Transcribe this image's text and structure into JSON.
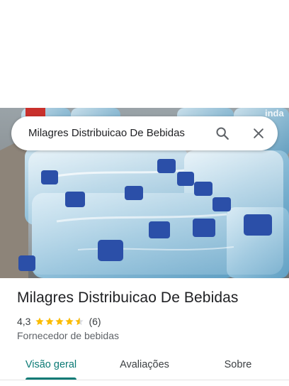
{
  "search": {
    "query": "Milagres Distribuicao De Bebidas"
  },
  "place": {
    "name": "Milagres Distribuicao De Bebidas",
    "rating": "4,3",
    "rating_value": 4.3,
    "review_count": "(6)",
    "category": "Fornecedor de bebidas"
  },
  "tabs": [
    {
      "label": "Visão geral",
      "active": true
    },
    {
      "label": "Avaliações",
      "active": false
    },
    {
      "label": "Sobre",
      "active": false
    }
  ],
  "colors": {
    "accent": "#0b7a75",
    "star": "#fbbc04"
  },
  "icons": [
    "search-icon",
    "close-icon",
    "star-icon"
  ]
}
